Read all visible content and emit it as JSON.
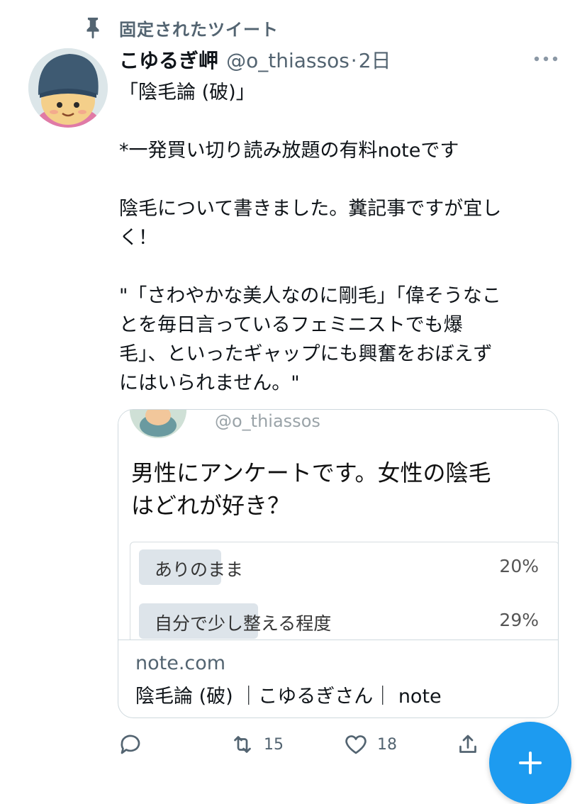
{
  "pinned": {
    "label": "固定されたツイート",
    "icon": "pin-icon"
  },
  "tweet": {
    "author": {
      "display_name": "こゆるぎ岬",
      "handle": "@o_thiassos",
      "separator": "·",
      "time": "2日"
    },
    "lines": [
      "「陰毛論 (破)」",
      "",
      "*一発買い切り読み放題の有料noteです",
      "",
      "陰毛について書きました。糞記事ですが宜し",
      "く！",
      "",
      "\"「さわやかな美人なのに剛毛」「偉そうなこ",
      "とを毎日言っているフェミニストでも爆",
      "毛」、といったギャップにも興奮をおぼえず",
      "にはいられません。\""
    ]
  },
  "card": {
    "image": {
      "handle": "@o_thiassos",
      "question_lines": [
        "男性にアンケートです。女性の陰毛",
        "はどれが好き？"
      ],
      "poll": [
        {
          "label": "ありのまま",
          "percent": "20%",
          "fill": 0.2
        },
        {
          "label": "自分で少し整える程度",
          "percent": "29%",
          "fill": 0.29
        }
      ]
    },
    "domain": "note.com",
    "title": "陰毛論 (破) ｜こゆるぎさん｜ note"
  },
  "actions": {
    "reply": {
      "icon": "reply-icon"
    },
    "retweet": {
      "icon": "retweet-icon",
      "count": "15"
    },
    "like": {
      "icon": "like-icon",
      "count": "18"
    },
    "share": {
      "icon": "share-icon"
    }
  },
  "fab": {
    "icon": "compose-plus-icon",
    "color": "#1d9bf0"
  },
  "colors": {
    "accent": "#1d9bf0",
    "secondary_text": "#536471",
    "border": "#cfd9de"
  }
}
